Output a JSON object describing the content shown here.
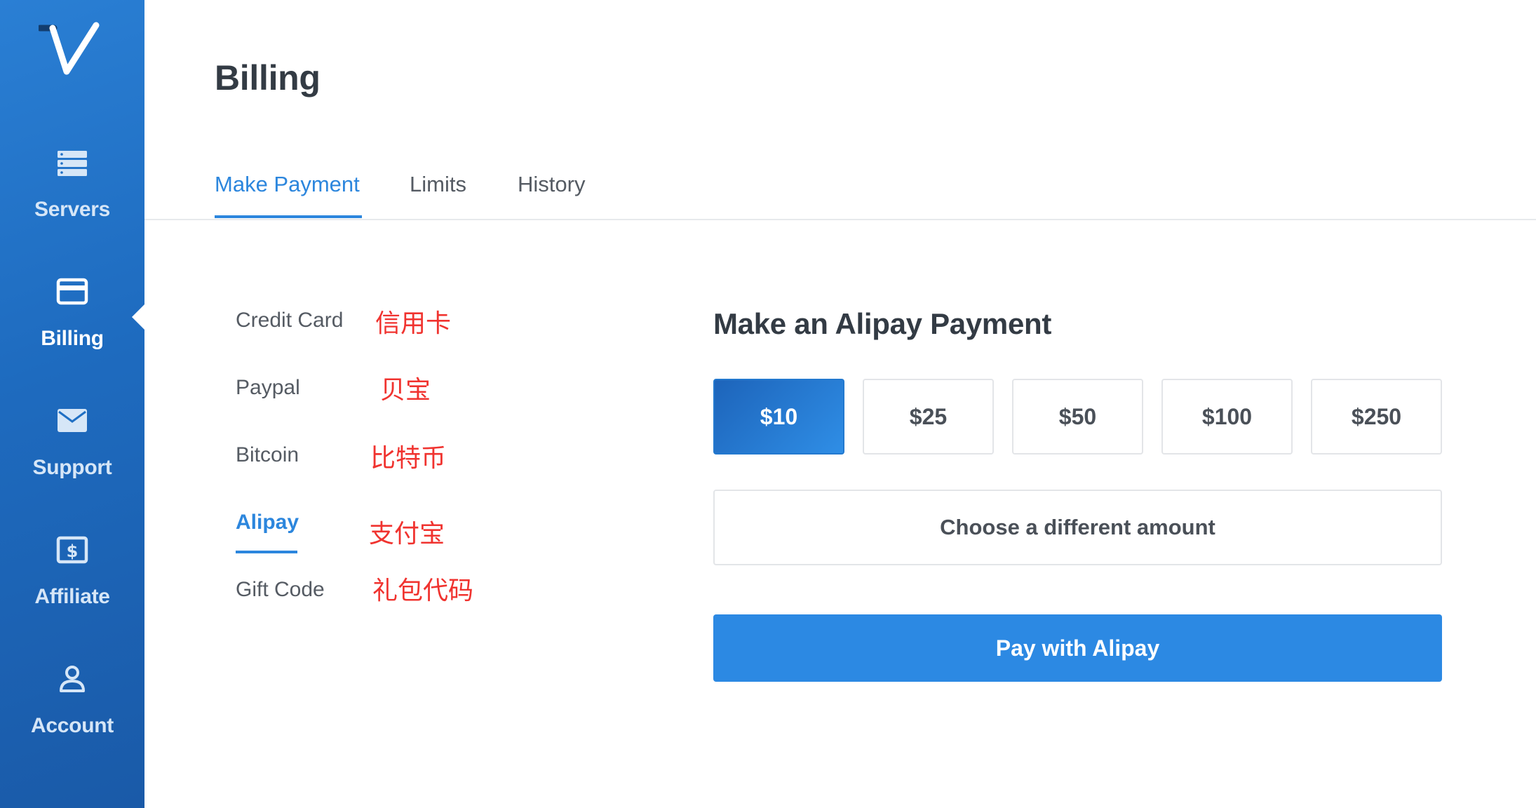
{
  "colors": {
    "sidebar_bg": "#1f6fc4",
    "accent": "#2c86dd",
    "annotation": "#f0332f",
    "button_primary": "#2c89e3"
  },
  "sidebar": {
    "logo_icon": "vultr-v-logo",
    "items": [
      {
        "label": "Servers",
        "icon": "server-icon"
      },
      {
        "label": "Billing",
        "icon": "credit-card-icon",
        "active": true
      },
      {
        "label": "Support",
        "icon": "envelope-icon"
      },
      {
        "label": "Affiliate",
        "icon": "dollar-bill-icon"
      },
      {
        "label": "Account",
        "icon": "user-icon"
      }
    ]
  },
  "page": {
    "title": "Billing"
  },
  "tabs": [
    {
      "label": "Make Payment",
      "active": true
    },
    {
      "label": "Limits"
    },
    {
      "label": "History"
    }
  ],
  "methods": [
    {
      "label": "Credit Card",
      "annotation": "信用卡"
    },
    {
      "label": "Paypal",
      "annotation": "贝宝"
    },
    {
      "label": "Bitcoin",
      "annotation": "比特币"
    },
    {
      "label": "Alipay",
      "annotation": "支付宝",
      "active": true
    },
    {
      "label": "Gift Code",
      "annotation": "礼包代码"
    }
  ],
  "payment": {
    "title": "Make an Alipay Payment",
    "amounts": [
      "$10",
      "$25",
      "$50",
      "$100",
      "$250"
    ],
    "selected_amount": "$10",
    "different_label": "Choose a different amount",
    "pay_label": "Pay with Alipay"
  }
}
